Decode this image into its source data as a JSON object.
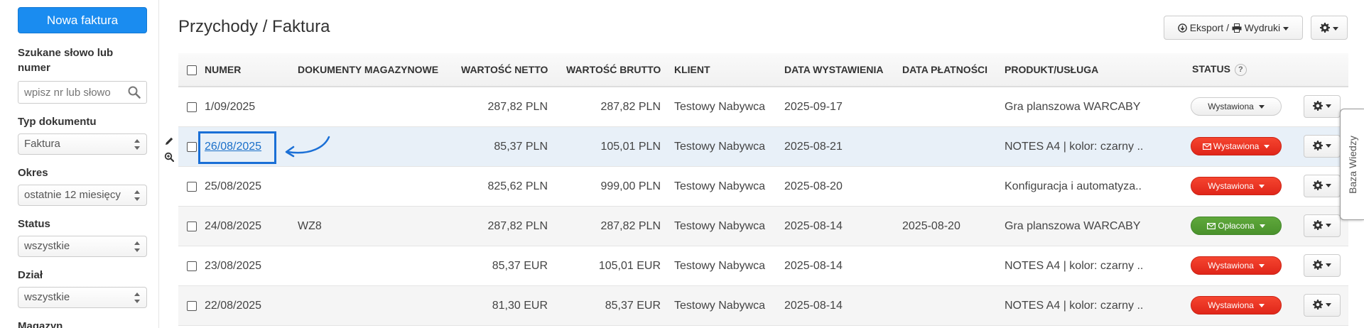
{
  "sidebar": {
    "new_invoice_button": "Nowa faktura",
    "search": {
      "label": "Szukane słowo lub numer",
      "placeholder": "wpisz nr lub słowo"
    },
    "filters": [
      {
        "label": "Typ dokumentu",
        "value": "Faktura"
      },
      {
        "label": "Okres",
        "value": "ostatnie 12 miesięcy"
      },
      {
        "label": "Status",
        "value": "wszystkie"
      },
      {
        "label": "Dział",
        "value": "wszystkie"
      }
    ],
    "warehouse_label": "Magazyn"
  },
  "header": {
    "title": "Przychody / Faktura",
    "export_label": "Eksport",
    "separator": "/",
    "print_label": "Wydruki"
  },
  "table": {
    "columns": [
      "NUMER",
      "DOKUMENTY MAGAZYNOWE",
      "WARTOŚĆ NETTO",
      "WARTOŚĆ BRUTTO",
      "KLIENT",
      "DATA WYSTAWIENIA",
      "DATA PŁATNOŚCI",
      "PRODUKT/USŁUGA",
      "STATUS"
    ],
    "status_help": "?",
    "rows": [
      {
        "number": "1/09/2025",
        "warehouse_docs": "",
        "net": "287,82 PLN",
        "gross": "287,82 PLN",
        "client": "Testowy Nabywca",
        "issue_date": "2025-09-17",
        "payment_date": "",
        "product": "Gra planszowa WARCABY",
        "status": "Wystawiona",
        "status_color": "#f2f2f2",
        "status_style": "white",
        "status_icon": ""
      },
      {
        "number": "26/08/2025",
        "warehouse_docs": "",
        "net": "85,37 PLN",
        "gross": "105,01 PLN",
        "client": "Testowy Nabywca",
        "issue_date": "2025-08-21",
        "payment_date": "",
        "product": "NOTES A4 | kolor: czarny ..",
        "status": "Wystawiona",
        "status_color": "#e8321f",
        "status_style": "red",
        "status_icon": "envelope-icon"
      },
      {
        "number": "25/08/2025",
        "warehouse_docs": "",
        "net": "825,62 PLN",
        "gross": "999,00 PLN",
        "client": "Testowy Nabywca",
        "issue_date": "2025-08-20",
        "payment_date": "",
        "product": "Konfiguracja i automatyza..",
        "status": "Wystawiona",
        "status_color": "#e8321f",
        "status_style": "red",
        "status_icon": ""
      },
      {
        "number": "24/08/2025",
        "warehouse_docs": "WZ8",
        "net": "287,82 PLN",
        "gross": "287,82 PLN",
        "client": "Testowy Nabywca",
        "issue_date": "2025-08-14",
        "payment_date": "2025-08-20",
        "product": "Gra planszowa WARCABY",
        "status": "Opłacona",
        "status_color": "#52992f",
        "status_style": "green",
        "status_icon": "envelope-icon"
      },
      {
        "number": "23/08/2025",
        "warehouse_docs": "",
        "net": "85,37 EUR",
        "gross": "105,01 EUR",
        "client": "Testowy Nabywca",
        "issue_date": "2025-08-14",
        "payment_date": "",
        "product": "NOTES A4 | kolor: czarny ..",
        "status": "Wystawiona",
        "status_color": "#e8321f",
        "status_style": "red",
        "status_icon": ""
      },
      {
        "number": "22/08/2025",
        "warehouse_docs": "",
        "net": "81,30 EUR",
        "gross": "85,37 EUR",
        "client": "Testowy Nabywca",
        "issue_date": "2025-08-14",
        "payment_date": "",
        "product": "NOTES A4 | kolor: czarny ..",
        "status": "Wystawiona",
        "status_color": "#e8321f",
        "status_style": "red",
        "status_icon": ""
      }
    ]
  },
  "knowledge_base_tab": "Baza Wiedzy",
  "colors": {
    "primary": "#1a8cf0",
    "link": "#1a6fc9",
    "highlight_box": "#1a6fd6",
    "row_highlight": "#e8f0f8"
  }
}
